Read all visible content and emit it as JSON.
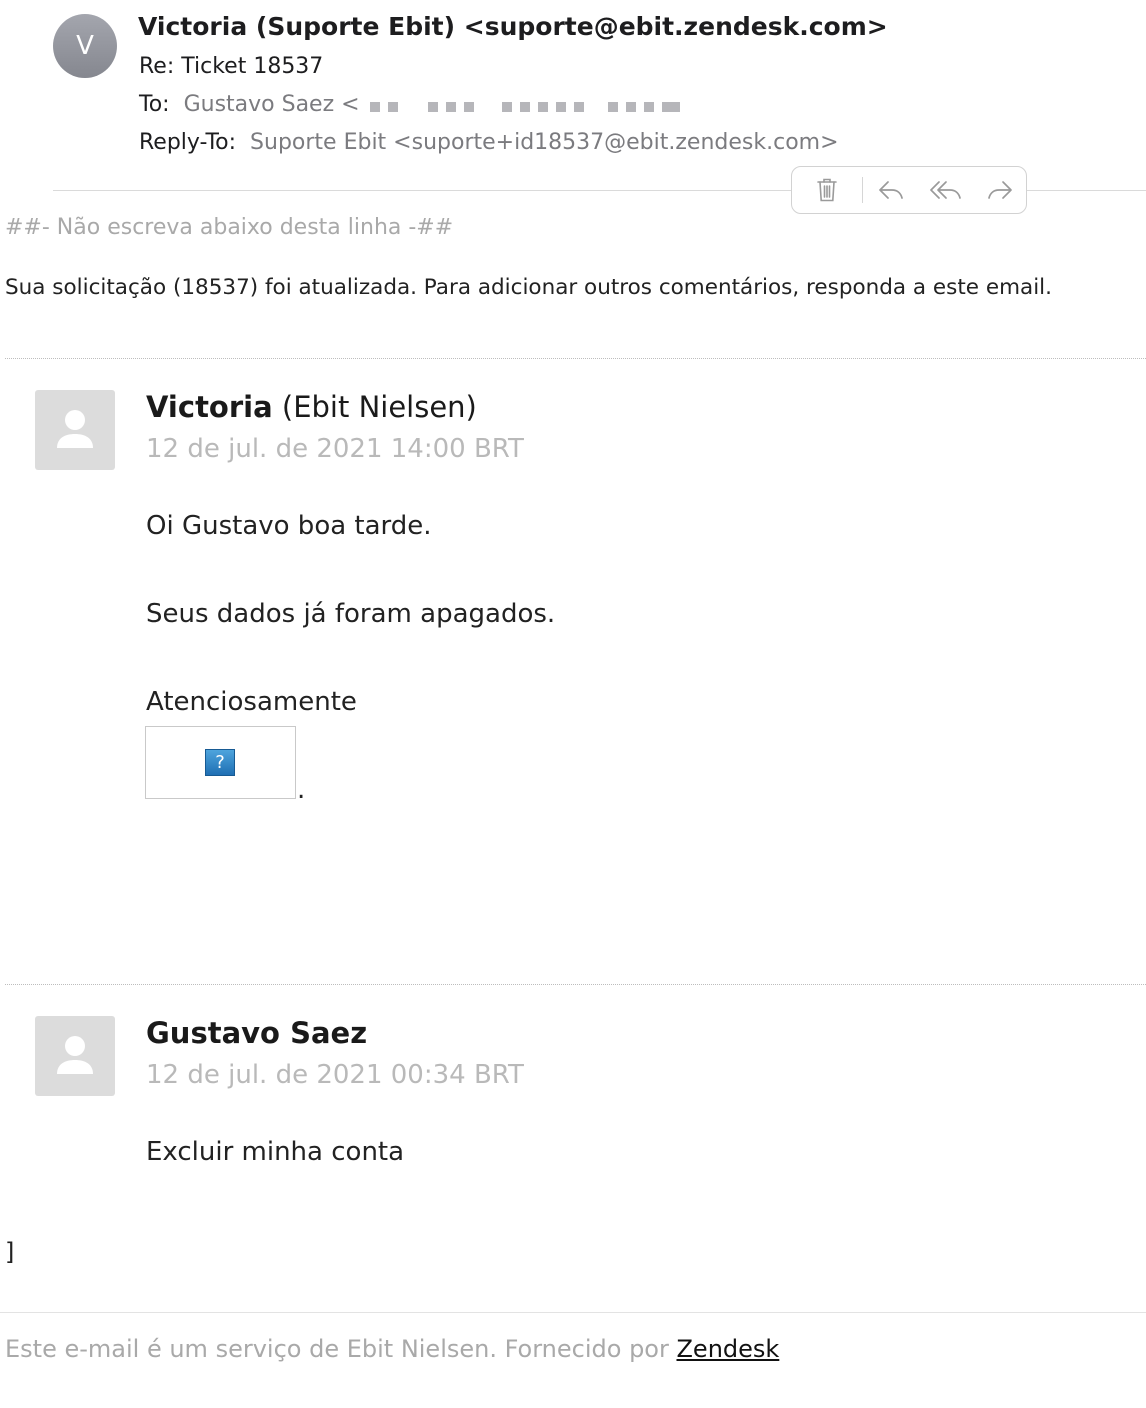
{
  "header": {
    "avatar_letter": "V",
    "from": "Victoria (Suporte Ebit) <suporte@ebit.zendesk.com>",
    "subject": "Re: Ticket 18537",
    "to_label": "To:",
    "to_value": "Gustavo Saez <",
    "reply_to_label": "Reply-To:",
    "reply_to_value": "Suporte Ebit <suporte+id18537@ebit.zendesk.com>"
  },
  "toolbar": {
    "icons": [
      "trash-icon",
      "reply-icon",
      "reply-all-icon",
      "forward-icon"
    ]
  },
  "body": {
    "notice": "##- Não escreva abaixo desta linha -##",
    "intro": "Sua solicitação (18537) foi atualizada. Para adicionar outros comentários, responda a este email."
  },
  "comments": [
    {
      "author_name": "Victoria",
      "author_org": "(Ebit Nielsen)",
      "date": "12 de jul. de 2021 14:00 BRT",
      "lines": [
        "Oi Gustavo boa tarde.",
        "Seus dados já foram apagados.",
        "Atenciosamente"
      ],
      "image_placeholder": "?",
      "trailing": "."
    },
    {
      "author_name": "Gustavo Saez",
      "date": "12 de jul. de 2021 00:34 BRT",
      "lines": [
        "Excluir minha conta"
      ]
    }
  ],
  "stray_bracket": "]",
  "footer": {
    "text": "Este e-mail é um serviço de Ebit Nielsen. Fornecido por ",
    "link": "Zendesk"
  }
}
